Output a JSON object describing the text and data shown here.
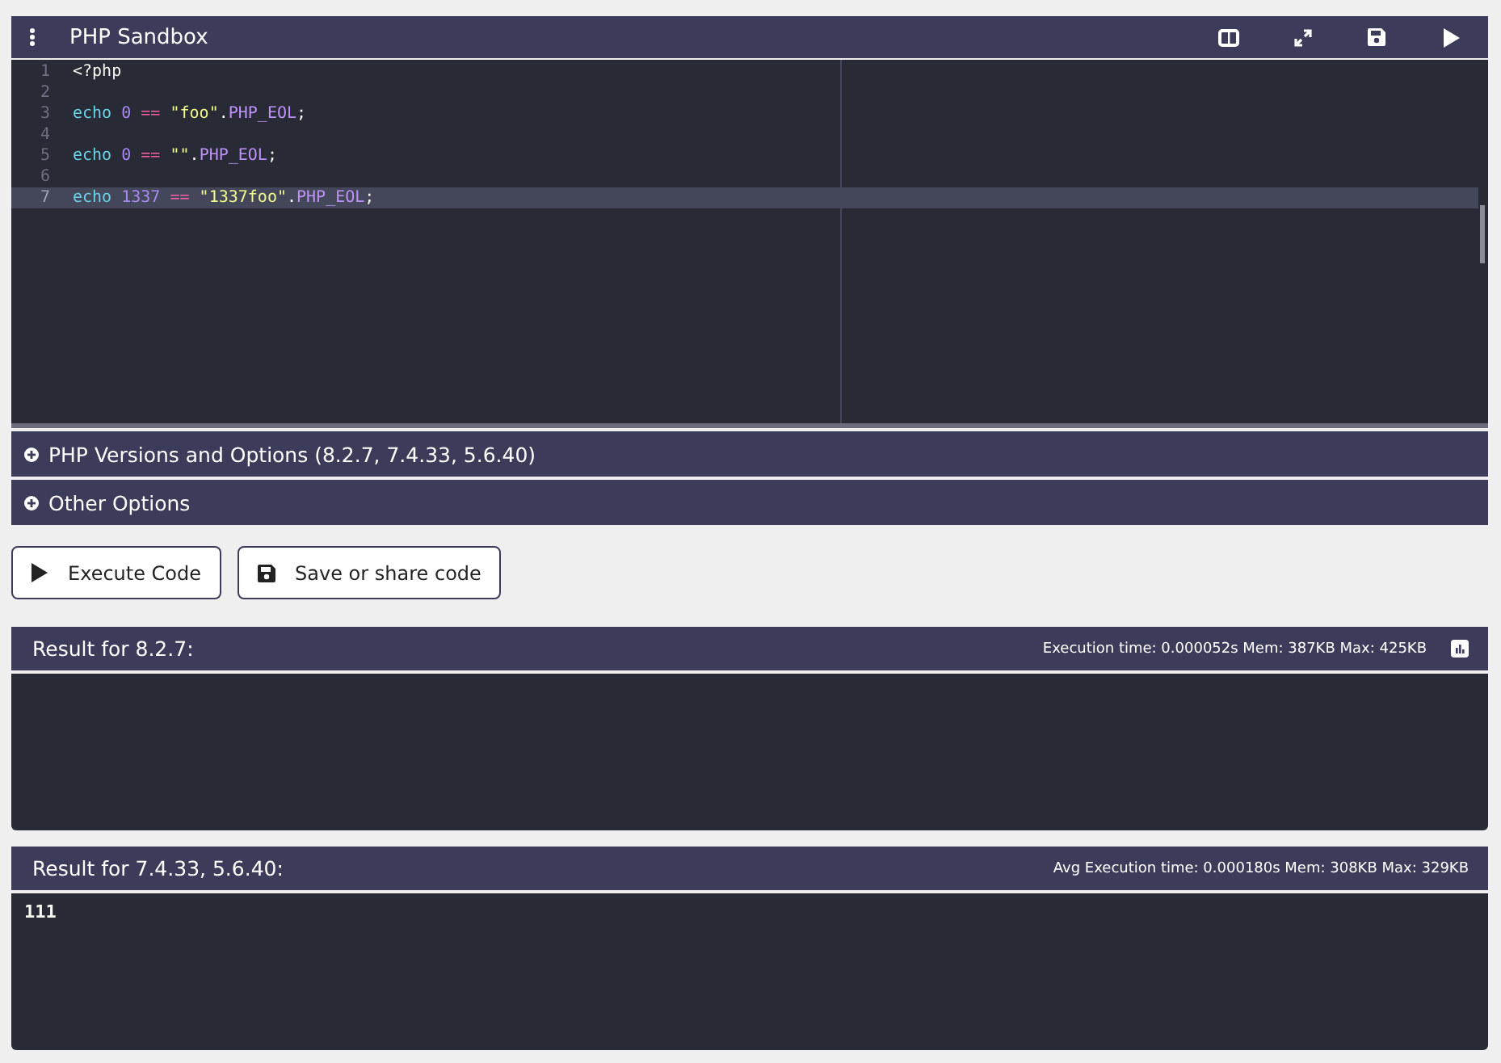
{
  "window": {
    "title": "PHP Sandbox"
  },
  "editor": {
    "lines": [
      {
        "number": "1",
        "active": false,
        "tokens": [
          {
            "kind": "plain",
            "text": "<?php"
          }
        ]
      },
      {
        "number": "2",
        "active": false
      },
      {
        "number": "3",
        "active": false,
        "tokens": [
          {
            "kind": "keyword",
            "text": "echo "
          },
          {
            "kind": "number",
            "text": "0"
          },
          {
            "kind": "operator",
            "text": " == "
          },
          {
            "kind": "string",
            "text": "\"foo\""
          },
          {
            "kind": "plain",
            "text": "."
          },
          {
            "kind": "constant",
            "text": "PHP_EOL"
          },
          {
            "kind": "plain",
            "text": ";"
          }
        ]
      },
      {
        "number": "4",
        "active": false
      },
      {
        "number": "5",
        "active": false,
        "tokens": [
          {
            "kind": "keyword",
            "text": "echo "
          },
          {
            "kind": "number",
            "text": "0"
          },
          {
            "kind": "operator",
            "text": " == "
          },
          {
            "kind": "string",
            "text": "\"\""
          },
          {
            "kind": "plain",
            "text": "."
          },
          {
            "kind": "constant",
            "text": "PHP_EOL"
          },
          {
            "kind": "plain",
            "text": ";"
          }
        ]
      },
      {
        "number": "6",
        "active": false
      },
      {
        "number": "7",
        "active": true,
        "tokens": [
          {
            "kind": "keyword",
            "text": "echo "
          },
          {
            "kind": "number",
            "text": "1337"
          },
          {
            "kind": "operator",
            "text": " == "
          },
          {
            "kind": "string",
            "text": "\"1337foo\""
          },
          {
            "kind": "plain",
            "text": "."
          },
          {
            "kind": "constant",
            "text": "PHP_EOL"
          },
          {
            "kind": "plain",
            "text": ";"
          }
        ]
      }
    ]
  },
  "sections": [
    {
      "label": "PHP Versions and Options (8.2.7, 7.4.33, 5.6.40)",
      "expanded": false
    },
    {
      "label": "Other Options",
      "expanded": false
    }
  ],
  "buttons": [
    {
      "kind": "execute",
      "label": "Execute Code"
    },
    {
      "kind": "save",
      "label": "Save or share code"
    }
  ],
  "results": [
    {
      "title": "Result for 8.2.7:",
      "stats": "Execution time: 0.000052s Mem: 387KB Max: 425KB",
      "chart_button": true
    },
    {
      "title": "Result for 7.4.33, 5.6.40:",
      "stats": "Avg Execution time: 0.000180s Mem: 308KB Max: 329KB",
      "chart_button": false,
      "output": "111"
    }
  ]
}
